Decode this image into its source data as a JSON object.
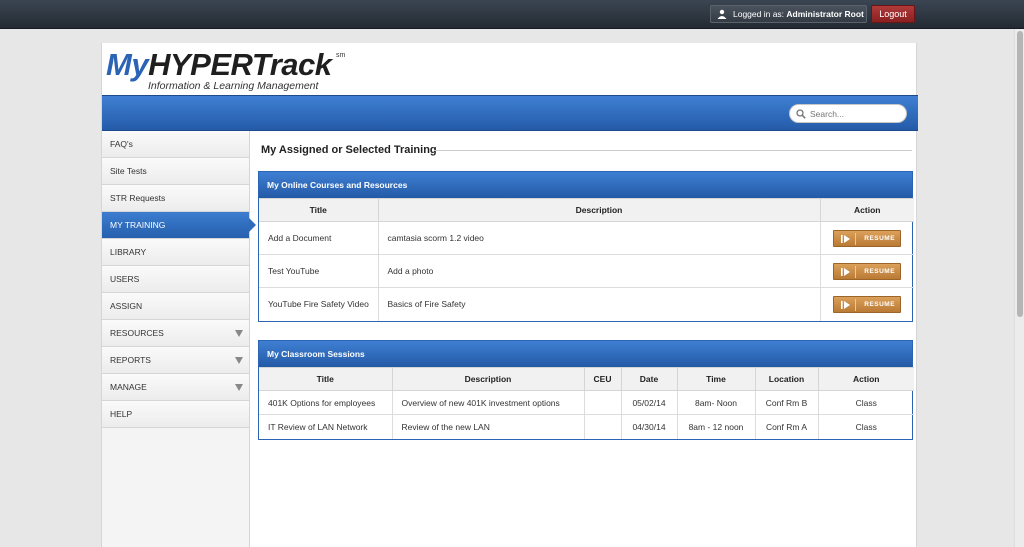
{
  "topbar": {
    "logged_in_prefix": "Logged in as:",
    "logged_in_user": "Administrator Root",
    "logout_label": "Logout",
    "user_icon": "user-icon"
  },
  "logo": {
    "my": "My",
    "hypertrack": "HYPERTrack",
    "sm": "sm",
    "tagline": "Information & Learning Management"
  },
  "search": {
    "placeholder": "Search...",
    "icon": "search-icon"
  },
  "sidebar": {
    "items": [
      {
        "label": "FAQ's"
      },
      {
        "label": "Site Tests"
      },
      {
        "label": "STR Requests"
      },
      {
        "label": "MY TRAINING",
        "active": true
      },
      {
        "label": "LIBRARY"
      },
      {
        "label": "USERS"
      },
      {
        "label": "ASSIGN"
      },
      {
        "label": "RESOURCES",
        "has_submenu": true
      },
      {
        "label": "REPORTS",
        "has_submenu": true
      },
      {
        "label": "MANAGE",
        "has_submenu": true
      },
      {
        "label": "HELP"
      }
    ]
  },
  "main": {
    "title": "My Assigned or Selected Training",
    "online": {
      "heading": "My Online Courses and Resources",
      "columns": [
        "Title",
        "Description",
        "Action"
      ],
      "rows": [
        {
          "title": "Add a Document",
          "description": "camtasia scorm 1.2 video",
          "action": "RESUME"
        },
        {
          "title": "Test YouTube",
          "description": "Add a photo",
          "action": "RESUME"
        },
        {
          "title": "YouTube Fire Safety Video",
          "description": "Basics of Fire Safety",
          "action": "RESUME"
        }
      ]
    },
    "classroom": {
      "heading": "My Classroom Sessions",
      "columns": [
        "Title",
        "Description",
        "CEU",
        "Date",
        "Time",
        "Location",
        "Action"
      ],
      "rows": [
        {
          "title": "401K Options for employees",
          "description": "Overview of new 401K investment options",
          "ceu": "",
          "date": "05/02/14",
          "time": "8am- Noon",
          "location": "Conf Rm B",
          "action": "Class"
        },
        {
          "title": "IT Review of LAN Network",
          "description": "Review of the new LAN",
          "ceu": "",
          "date": "04/30/14",
          "time": "8am - 12 noon",
          "location": "Conf Rm A",
          "action": "Class"
        }
      ]
    }
  },
  "colors": {
    "brand_blue": "#2b63b5",
    "logout_red": "#9c2a2a",
    "resume_orange": "#c98a42",
    "topbar": "#2c343e"
  }
}
